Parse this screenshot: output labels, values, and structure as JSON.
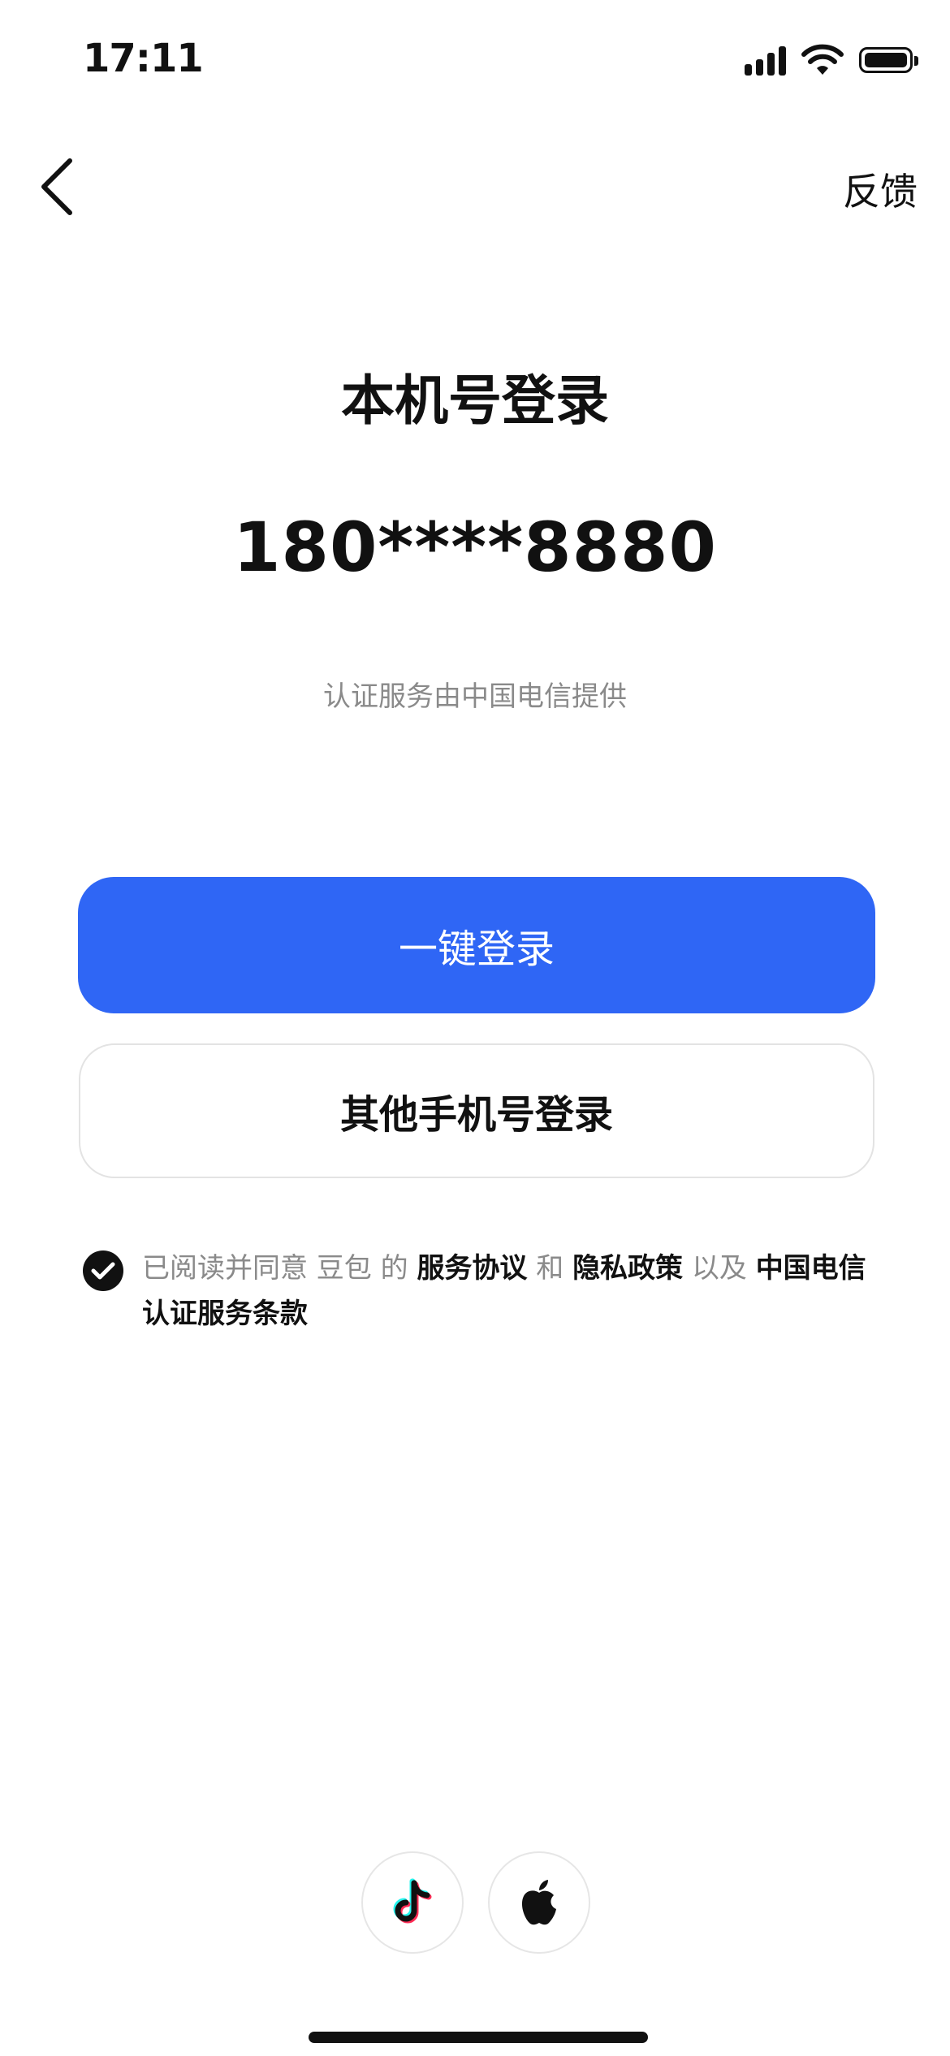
{
  "status_bar": {
    "time": "17:11"
  },
  "nav": {
    "back_icon": "chevron-left-icon",
    "feedback_label": "反馈"
  },
  "main": {
    "title": "本机号登录",
    "phone_number": "180****8880",
    "auth_provider": "认证服务由中国电信提供"
  },
  "buttons": {
    "one_click_login": "一键登录",
    "other_number_login": "其他手机号登录"
  },
  "agreement": {
    "checked": true,
    "prefix": "已阅读并同意 豆包 的 ",
    "service_agreement": "服务协议",
    "and": " 和 ",
    "privacy_policy": "隐私政策",
    "and_also": " 以及 ",
    "telecom_terms": "中国电信认证服务条款"
  },
  "third_party": {
    "douyin_icon": "douyin-logo-icon",
    "apple_icon": "apple-logo-icon"
  },
  "colors": {
    "primary": "#2f66f5",
    "text": "#111111",
    "muted": "#8a8a8a"
  }
}
